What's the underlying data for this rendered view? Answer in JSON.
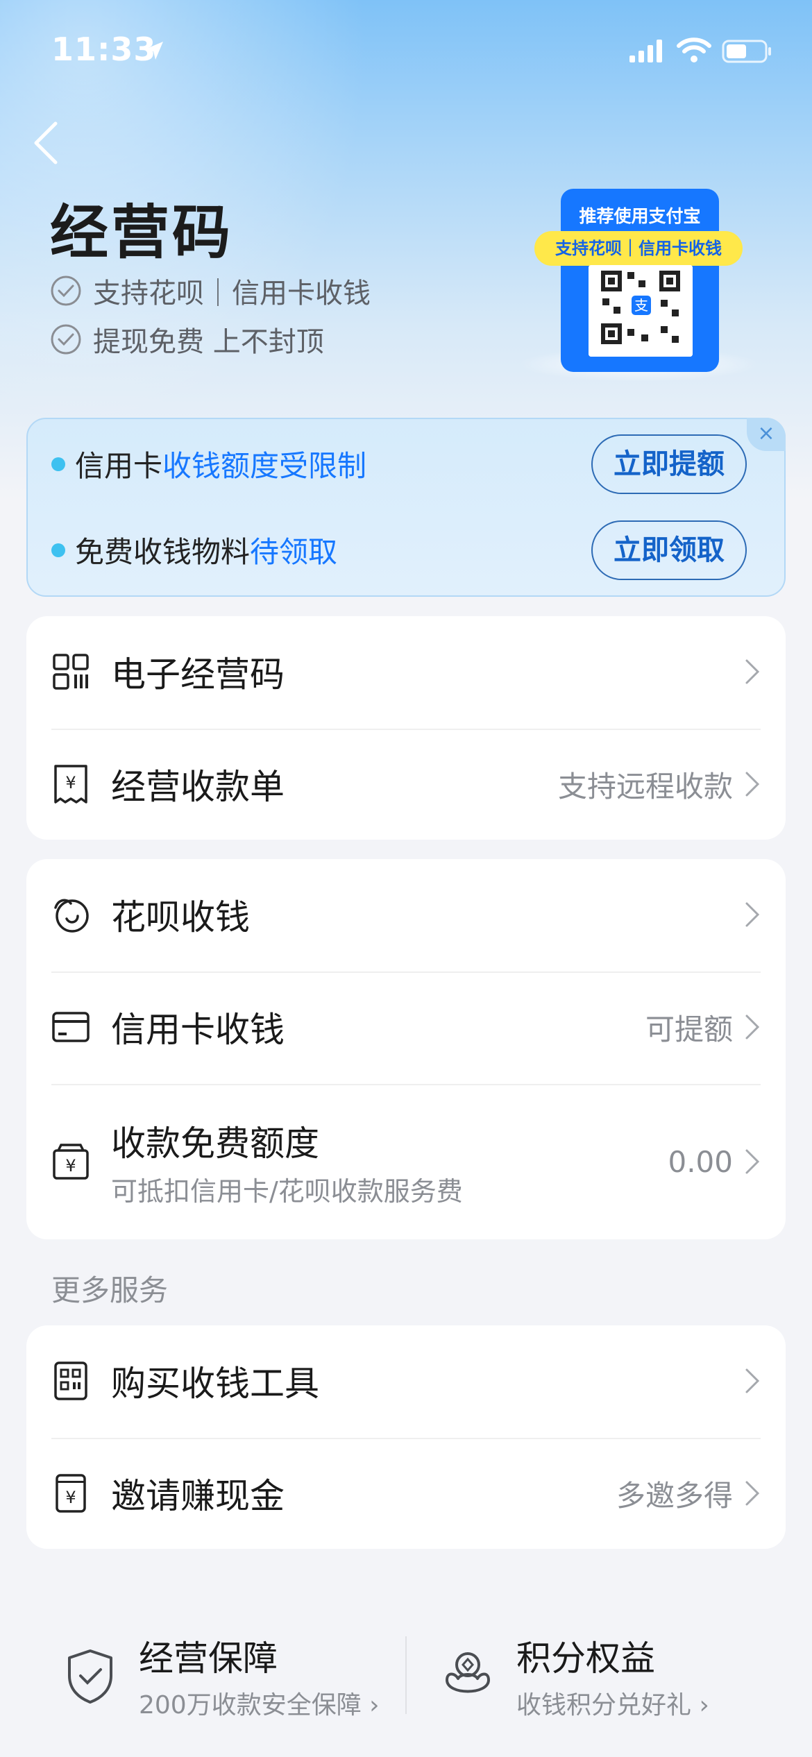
{
  "status_bar": {
    "time": "11:33"
  },
  "header": {
    "title": "经营码",
    "features": [
      "支持花呗｜信用卡收钱",
      "提现免费 上不封顶"
    ]
  },
  "promo": {
    "title": "推荐使用支付宝",
    "ribbon": "支持花呗｜信用卡收钱"
  },
  "alert": {
    "close_glyph": "×",
    "rows": [
      {
        "prefix": "信用卡",
        "highlight": "收钱额度受限制",
        "button": "立即提额"
      },
      {
        "prefix": "免费收钱物料",
        "highlight": "待领取",
        "button": "立即领取"
      }
    ]
  },
  "card1": {
    "items": [
      {
        "label": "电子经营码",
        "value": "",
        "icon": "qr-grid-icon"
      },
      {
        "label": "经营收款单",
        "value": "支持远程收款",
        "icon": "receipt-icon"
      }
    ]
  },
  "card2": {
    "items": [
      {
        "label": "花呗收钱",
        "value": "",
        "icon": "huabei-icon"
      },
      {
        "label": "信用卡收钱",
        "value": "可提额",
        "icon": "credit-card-icon"
      },
      {
        "label": "收款免费额度",
        "sub": "可抵扣信用卡/花呗收款服务费",
        "value": "0.00",
        "icon": "wallet-yen-icon"
      }
    ]
  },
  "more_services": {
    "title": "更多服务",
    "items": [
      {
        "label": "购买收钱工具",
        "value": "",
        "icon": "qr-tool-icon"
      },
      {
        "label": "邀请赚现金",
        "value": "多邀多得",
        "icon": "invite-cash-icon"
      }
    ]
  },
  "bottom": [
    {
      "title": "经营保障",
      "sub": "200万收款安全保障",
      "icon": "shield-check-icon"
    },
    {
      "title": "积分权益",
      "sub": "收钱积分兑好礼",
      "icon": "points-icon"
    }
  ],
  "colors": {
    "accent": "#1677ff",
    "dot": "#3ec1f0",
    "promo_ribbon": "#ffe84a"
  }
}
